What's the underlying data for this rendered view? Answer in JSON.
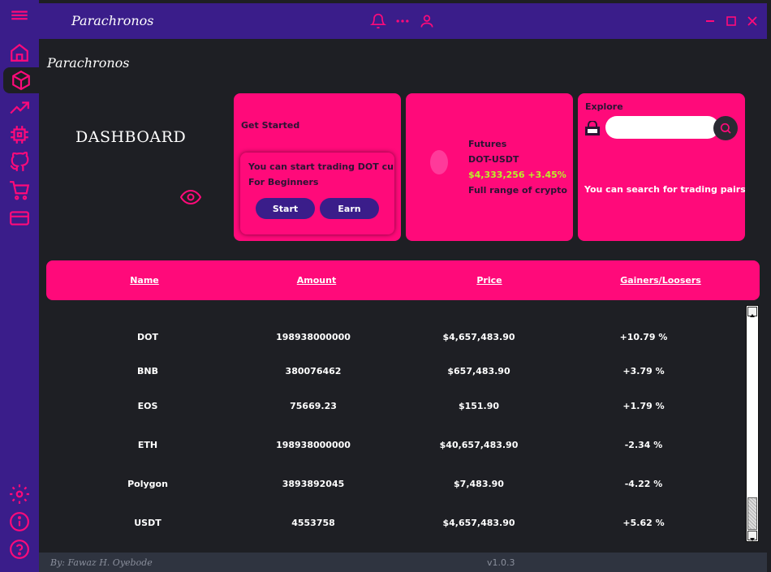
{
  "app": {
    "title": "Parachronos"
  },
  "main": {
    "page_title": "Parachronos",
    "dashboard_label": "DASHBOARD"
  },
  "cards": {
    "get_started": {
      "heading": "Get Started",
      "message": "You can start trading DOT currency",
      "subtext": "For Beginners",
      "start_label": "Start",
      "earn_label": "Earn"
    },
    "futures": {
      "heading": "Futures",
      "pair": "DOT-USDT",
      "price": "$4,333,256 +3.45%",
      "description": "Full range of crypto"
    },
    "explore": {
      "heading": "Explore",
      "search_value": "",
      "description": "You can search for trading pairs and more"
    }
  },
  "table": {
    "headers": [
      "Name",
      "Amount",
      "Price",
      "Gainers/Loosers"
    ],
    "rows": [
      {
        "name": "DOT",
        "amount": "198938000000",
        "price": "$4,657,483.90",
        "change": "+10.79 %"
      },
      {
        "name": "BNB",
        "amount": "380076462",
        "price": "$657,483.90",
        "change": "+3.79 %"
      },
      {
        "name": "EOS",
        "amount": "75669.23",
        "price": "$151.90",
        "change": "+1.79 %"
      },
      {
        "name": "ETH",
        "amount": "198938000000",
        "price": "$40,657,483.90",
        "change": "-2.34 %"
      },
      {
        "name": "Polygon",
        "amount": "3893892045",
        "price": "$7,483.90",
        "change": "-4.22 %"
      },
      {
        "name": "USDT",
        "amount": "4553758",
        "price": "$4,657,483.90",
        "change": "+5.62 %"
      }
    ]
  },
  "footer": {
    "author": "By: Fawaz H. Oyebode",
    "version": "v1.0.3"
  },
  "icons": {
    "sidebar": [
      "menu-icon",
      "home-icon",
      "cube-icon",
      "trending-up-icon",
      "chip-icon",
      "github-icon",
      "cart-icon",
      "credit-card-icon",
      "settings-icon",
      "info-icon",
      "help-icon"
    ],
    "titlebar": [
      "bell-icon",
      "more-icon",
      "user-icon",
      "minimize-icon",
      "maximize-icon",
      "close-icon"
    ]
  },
  "colors": {
    "accent": "#ff0a7a",
    "sidebar": "#3a1d8a",
    "background": "#1e1f24",
    "positive": "#b9f22a"
  }
}
